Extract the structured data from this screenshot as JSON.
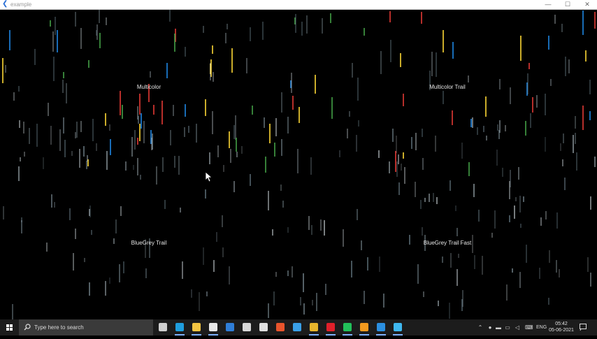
{
  "window": {
    "title": "example",
    "minimize": "—",
    "maximize": "☐",
    "close": "✕"
  },
  "panes": [
    {
      "id": "multicolor",
      "label": "Multicolor"
    },
    {
      "id": "multicolor-trail",
      "label": "Multicolor Trail"
    },
    {
      "id": "bluegrey-trail",
      "label": "BlueGrey Trail"
    },
    {
      "id": "bluegrey-trail-fast",
      "label": "BlueGrey Trail Fast"
    }
  ],
  "colors": {
    "multicolor": [
      "#e53935",
      "#43a047",
      "#1e88e5",
      "#fdd835"
    ],
    "bluegrey": [
      "#90a4ae",
      "#b0bec5",
      "#78909c",
      "#cfd8dc"
    ]
  },
  "taskbar": {
    "search_placeholder": "Type here to search",
    "apps": [
      {
        "name": "task-view",
        "icon": "task-view-icon",
        "color": "#cfcfcf"
      },
      {
        "name": "edge",
        "icon": "edge-icon",
        "color": "#1f9ede"
      },
      {
        "name": "file-explorer",
        "icon": "folder-icon",
        "color": "#f4c542"
      },
      {
        "name": "store",
        "icon": "store-icon",
        "color": "#e8e8e8"
      },
      {
        "name": "mail",
        "icon": "mail-icon",
        "color": "#2f7ed8"
      },
      {
        "name": "pen-app",
        "icon": "pen-icon",
        "color": "#d8d8d8"
      },
      {
        "name": "xbox",
        "icon": "xbox-icon",
        "color": "#e0e0e0"
      },
      {
        "name": "office",
        "icon": "office-icon",
        "color": "#e8542c"
      },
      {
        "name": "feather-app",
        "icon": "feather-icon",
        "color": "#3aa0e8"
      },
      {
        "name": "chrome",
        "icon": "chrome-icon",
        "color": "#e8b62c"
      },
      {
        "name": "opera",
        "icon": "opera-icon",
        "color": "#e0202a"
      },
      {
        "name": "messages-app",
        "icon": "chat-icon",
        "color": "#22c05a"
      },
      {
        "name": "sublime",
        "icon": "sublime-icon",
        "color": "#f39a1e"
      },
      {
        "name": "vscode",
        "icon": "vscode-icon",
        "color": "#2b8fe0"
      },
      {
        "name": "flutter-app",
        "icon": "flutter-icon",
        "color": "#3fb8f0"
      }
    ],
    "language": "ENG",
    "time": "05:42",
    "date": "05-06-2021"
  }
}
